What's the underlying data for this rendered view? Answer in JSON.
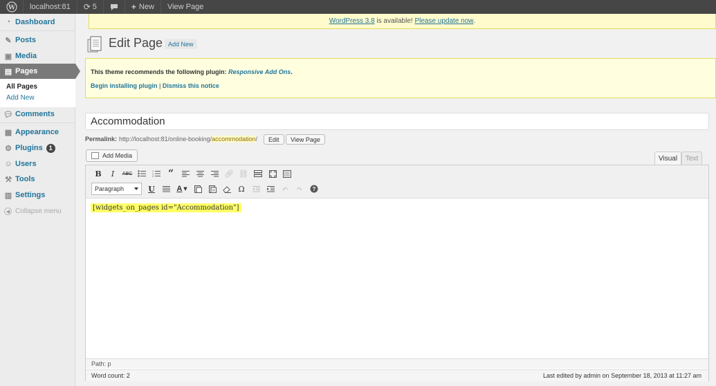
{
  "adminbar": {
    "site_name": "localhost:81",
    "updates_count": "5",
    "new_label": "New",
    "view_page_label": "View Page"
  },
  "sidebar": {
    "items": [
      {
        "label": "Dashboard",
        "icon": "dashboard-icon"
      },
      {
        "label": "Posts",
        "icon": "pin-icon"
      },
      {
        "label": "Media",
        "icon": "camera-icon"
      },
      {
        "label": "Pages",
        "icon": "pages-icon"
      },
      {
        "label": "Comments",
        "icon": "comment-icon"
      },
      {
        "label": "Appearance",
        "icon": "appearance-icon"
      },
      {
        "label": "Plugins",
        "icon": "plugin-icon",
        "badge": "1"
      },
      {
        "label": "Users",
        "icon": "users-icon"
      },
      {
        "label": "Tools",
        "icon": "tools-icon"
      },
      {
        "label": "Settings",
        "icon": "settings-icon"
      }
    ],
    "submenu": {
      "all_pages": "All Pages",
      "add_new": "Add New"
    },
    "collapse_label": "Collapse menu"
  },
  "update_nag": {
    "link1": "WordPress 3.8",
    "middle": " is available! ",
    "link2": "Please update now",
    "end": "."
  },
  "header": {
    "title": "Edit Page",
    "add_new_label": "Add New"
  },
  "notice": {
    "text": "This theme recommends the following plugin: ",
    "plugin_name": "Responsive Add Ons",
    "period": ".",
    "install_label": "Begin installing plugin",
    "separator": " | ",
    "dismiss_label": "Dismiss this notice"
  },
  "post": {
    "title": "Accommodation"
  },
  "permalink": {
    "label": "Permalink:",
    "base": "http://localhost:81/online-booking/",
    "slug": "accommodation",
    "trail": "/",
    "edit_label": "Edit",
    "view_label": "View Page"
  },
  "editor": {
    "add_media_label": "Add Media",
    "tab_visual": "Visual",
    "tab_text": "Text",
    "format_value": "Paragraph",
    "content": "[widgets_on_pages id=\"Accommodation\"]",
    "path": "Path: p",
    "word_count": "Word count: 2",
    "last_edited": "Last edited by admin on September 18, 2013 at 11:27 am"
  },
  "colors": {
    "link": "#21759b",
    "adminbar_bg": "#464646",
    "current_menu_bg": "#7a7a7a",
    "highlight": "#ffff66",
    "notice_bg": "#ffffe0"
  }
}
